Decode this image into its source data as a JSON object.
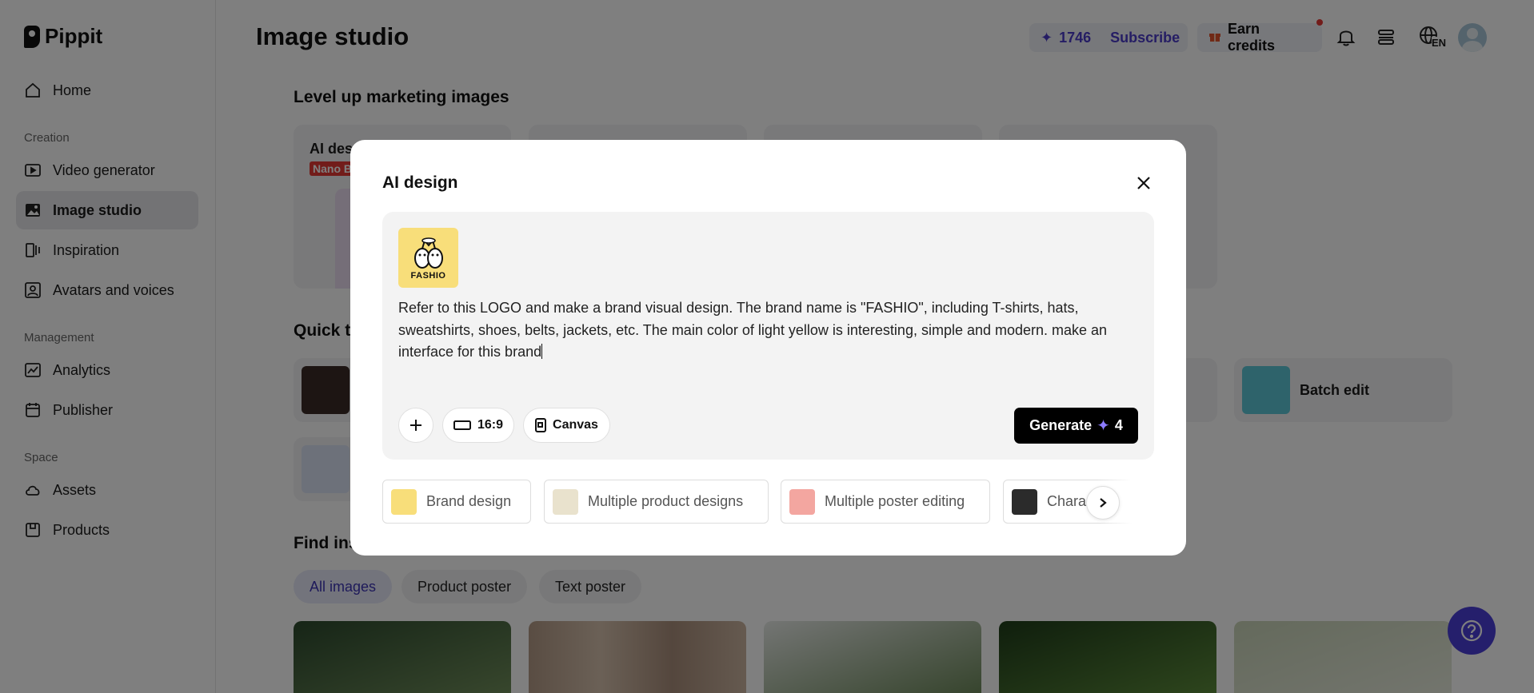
{
  "app": {
    "name": "Pippit"
  },
  "sidebar": {
    "items": [
      {
        "label": "Home",
        "icon": "home-icon"
      },
      {
        "section": "Creation"
      },
      {
        "label": "Video generator",
        "icon": "video-icon"
      },
      {
        "label": "Image studio",
        "icon": "image-icon",
        "active": true
      },
      {
        "label": "Inspiration",
        "icon": "inspiration-icon"
      },
      {
        "label": "Avatars and voices",
        "icon": "avatar-icon"
      },
      {
        "section": "Management"
      },
      {
        "label": "Analytics",
        "icon": "analytics-icon"
      },
      {
        "label": "Publisher",
        "icon": "calendar-icon"
      },
      {
        "section": "Space"
      },
      {
        "label": "Assets",
        "icon": "cloud-icon"
      },
      {
        "label": "Products",
        "icon": "box-icon"
      }
    ]
  },
  "header": {
    "title": "Image studio",
    "credits": "1746",
    "subscribe": "Subscribe",
    "earn_credits": "Earn credits",
    "language": "EN"
  },
  "main": {
    "section1_title": "Level up marketing images",
    "card1_title": "AI des",
    "card1_badge": "Nano B",
    "section2_title": "Quick t",
    "batch_edit": "Batch edit",
    "section3_title": "Find ins",
    "filters": [
      "All images",
      "Product poster",
      "Text poster"
    ]
  },
  "modal": {
    "title": "AI design",
    "logo_text": "FASHIO",
    "prompt": "Refer to this LOGO and make a brand visual design. The brand name is \"FASHIO\", including T-shirts, hats, sweatshirts, shoes, belts, jackets, etc. The main color of light yellow is interesting, simple and modern. make an interface for this brand",
    "ratio": "16:9",
    "canvas": "Canvas",
    "generate_label": "Generate",
    "generate_cost": "4",
    "chips": [
      "Brand design",
      "Multiple product designs",
      "Multiple poster editing",
      "Character r"
    ]
  },
  "colors": {
    "accent": "#4b3fd8",
    "credits_text": "#4a3bc9",
    "logo_yellow": "#f8de7a"
  }
}
